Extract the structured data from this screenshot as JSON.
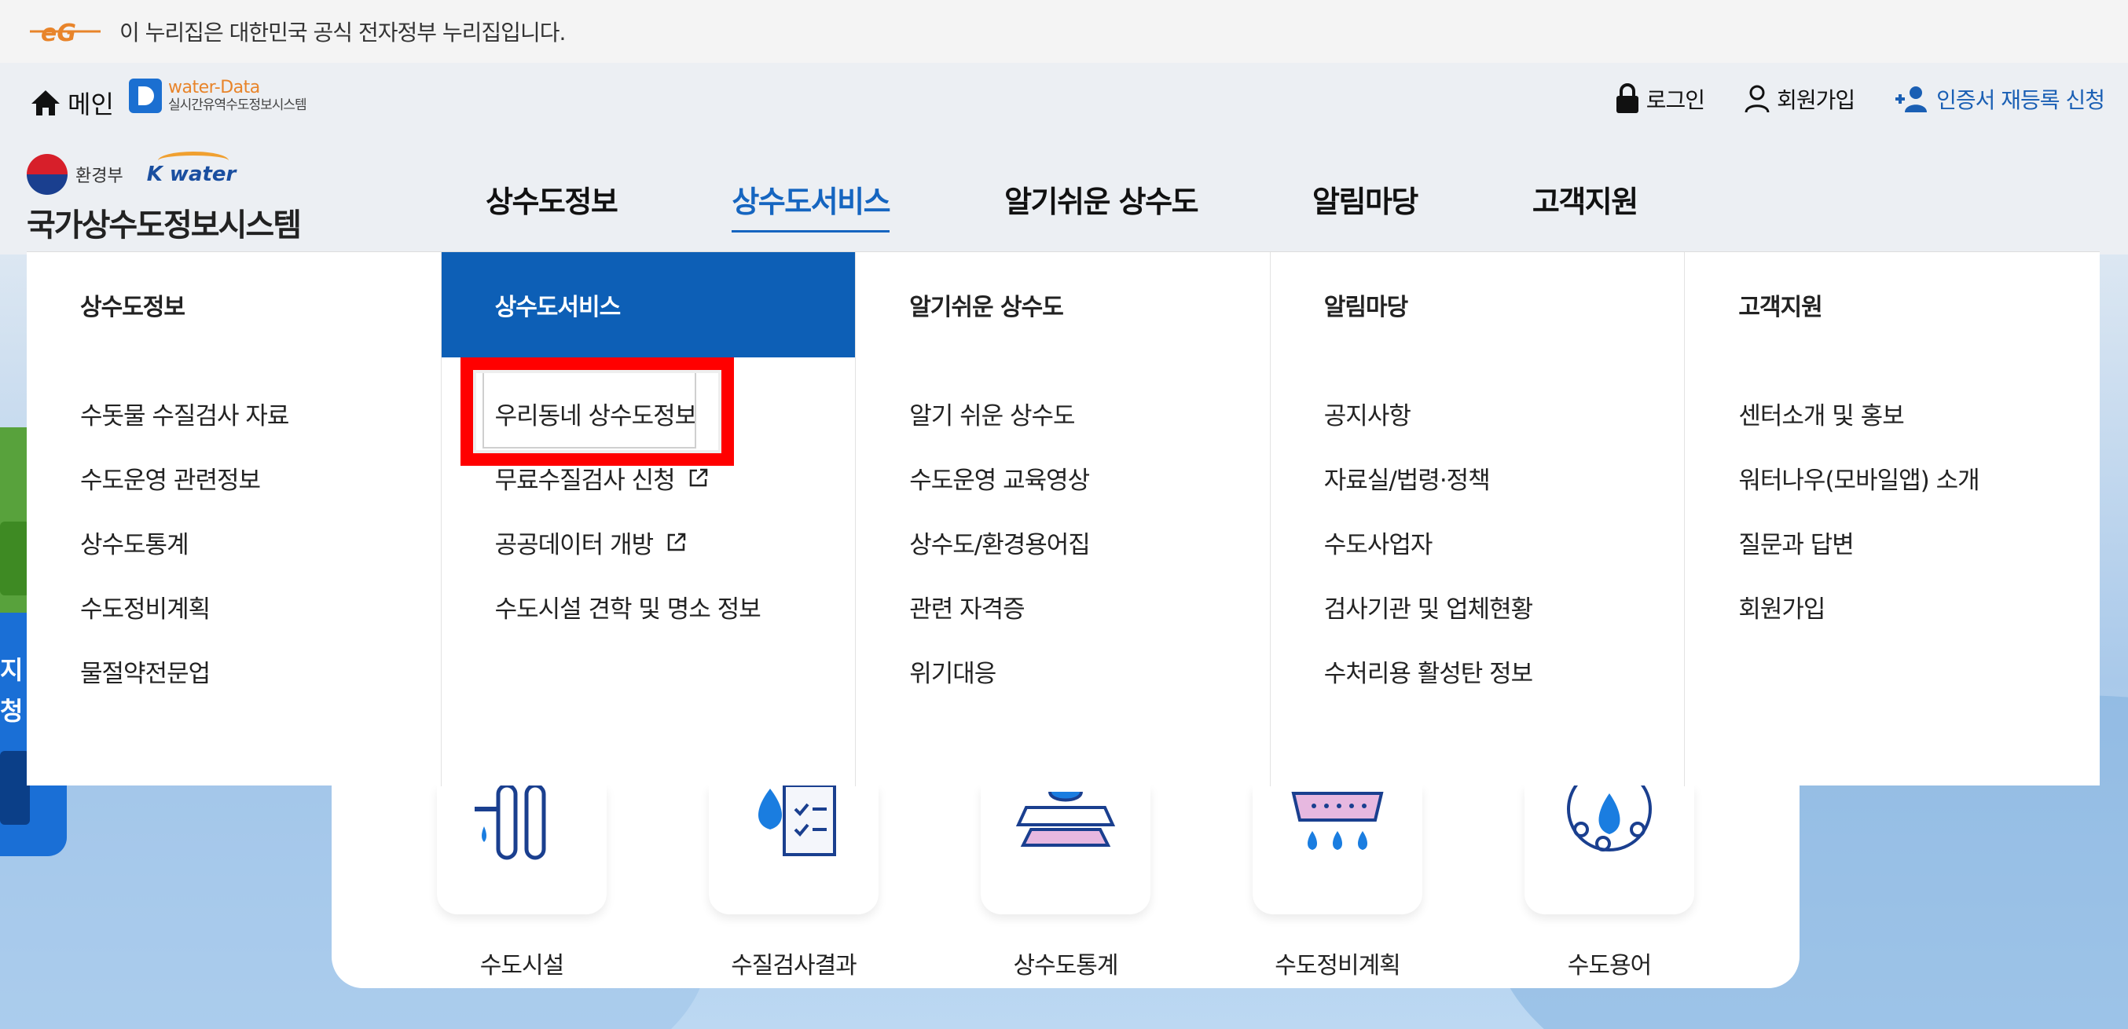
{
  "gov_banner": {
    "logo_text": "eG",
    "text": "이 누리집은 대한민국 공식 전자정부 누리집입니다."
  },
  "util_bar": {
    "home_label": "메인",
    "water_data_title": "water-Data",
    "water_data_subtitle": "실시간유역수도정보시스템",
    "login": "로그인",
    "signup": "회원가입",
    "cert_reregister": "인증서 재등록 신청"
  },
  "header": {
    "ministry": "환경부",
    "kwater": "K water",
    "site_name": "국가상수도정보시스템",
    "gnb": [
      {
        "label": "상수도정보"
      },
      {
        "label": "상수도서비스"
      },
      {
        "label": "알기쉬운 상수도"
      },
      {
        "label": "알림마당"
      },
      {
        "label": "고객지원"
      }
    ]
  },
  "mega_menu": [
    {
      "title": "상수도정보",
      "items": [
        "수돗물 수질검사 자료",
        "수도운영 관련정보",
        "상수도통계",
        "수도정비계획",
        "물절약전문업"
      ]
    },
    {
      "title": "상수도서비스",
      "items": [
        "우리동네 상수도정보",
        "무료수질검사 신청",
        "공공데이터 개방",
        "수도시설 견학 및 명소 정보"
      ]
    },
    {
      "title": "알기쉬운 상수도",
      "items": [
        "알기 쉬운 상수도",
        "수도운영 교육영상",
        "상수도/환경용어집",
        "관련 자격증",
        "위기대응"
      ]
    },
    {
      "title": "알림마당",
      "items": [
        "공지사항",
        "자료실/법령·정책",
        "수도사업자",
        "검사기관 및 업체현황",
        "수처리용 활성탄 정보"
      ]
    },
    {
      "title": "고객지원",
      "items": [
        "센터소개 및 홍보",
        "워터나우(모바일앱) 소개",
        "질문과 답변",
        "회원가입"
      ]
    }
  ],
  "side_banner": {
    "line1": "지",
    "line2": "청"
  },
  "quick_links": [
    {
      "label": "수도시설",
      "icon": "pipe-icon"
    },
    {
      "label": "수질검사결과",
      "icon": "water-report-icon"
    },
    {
      "label": "상수도통계",
      "icon": "layers-icon"
    },
    {
      "label": "수도정비계획",
      "icon": "filter-drops-icon"
    },
    {
      "label": "수도용어",
      "icon": "gear-drop-icon"
    }
  ],
  "colors": {
    "accent": "#1565c0",
    "active_column": "#0d5fb6",
    "highlight": "#ff0000"
  }
}
